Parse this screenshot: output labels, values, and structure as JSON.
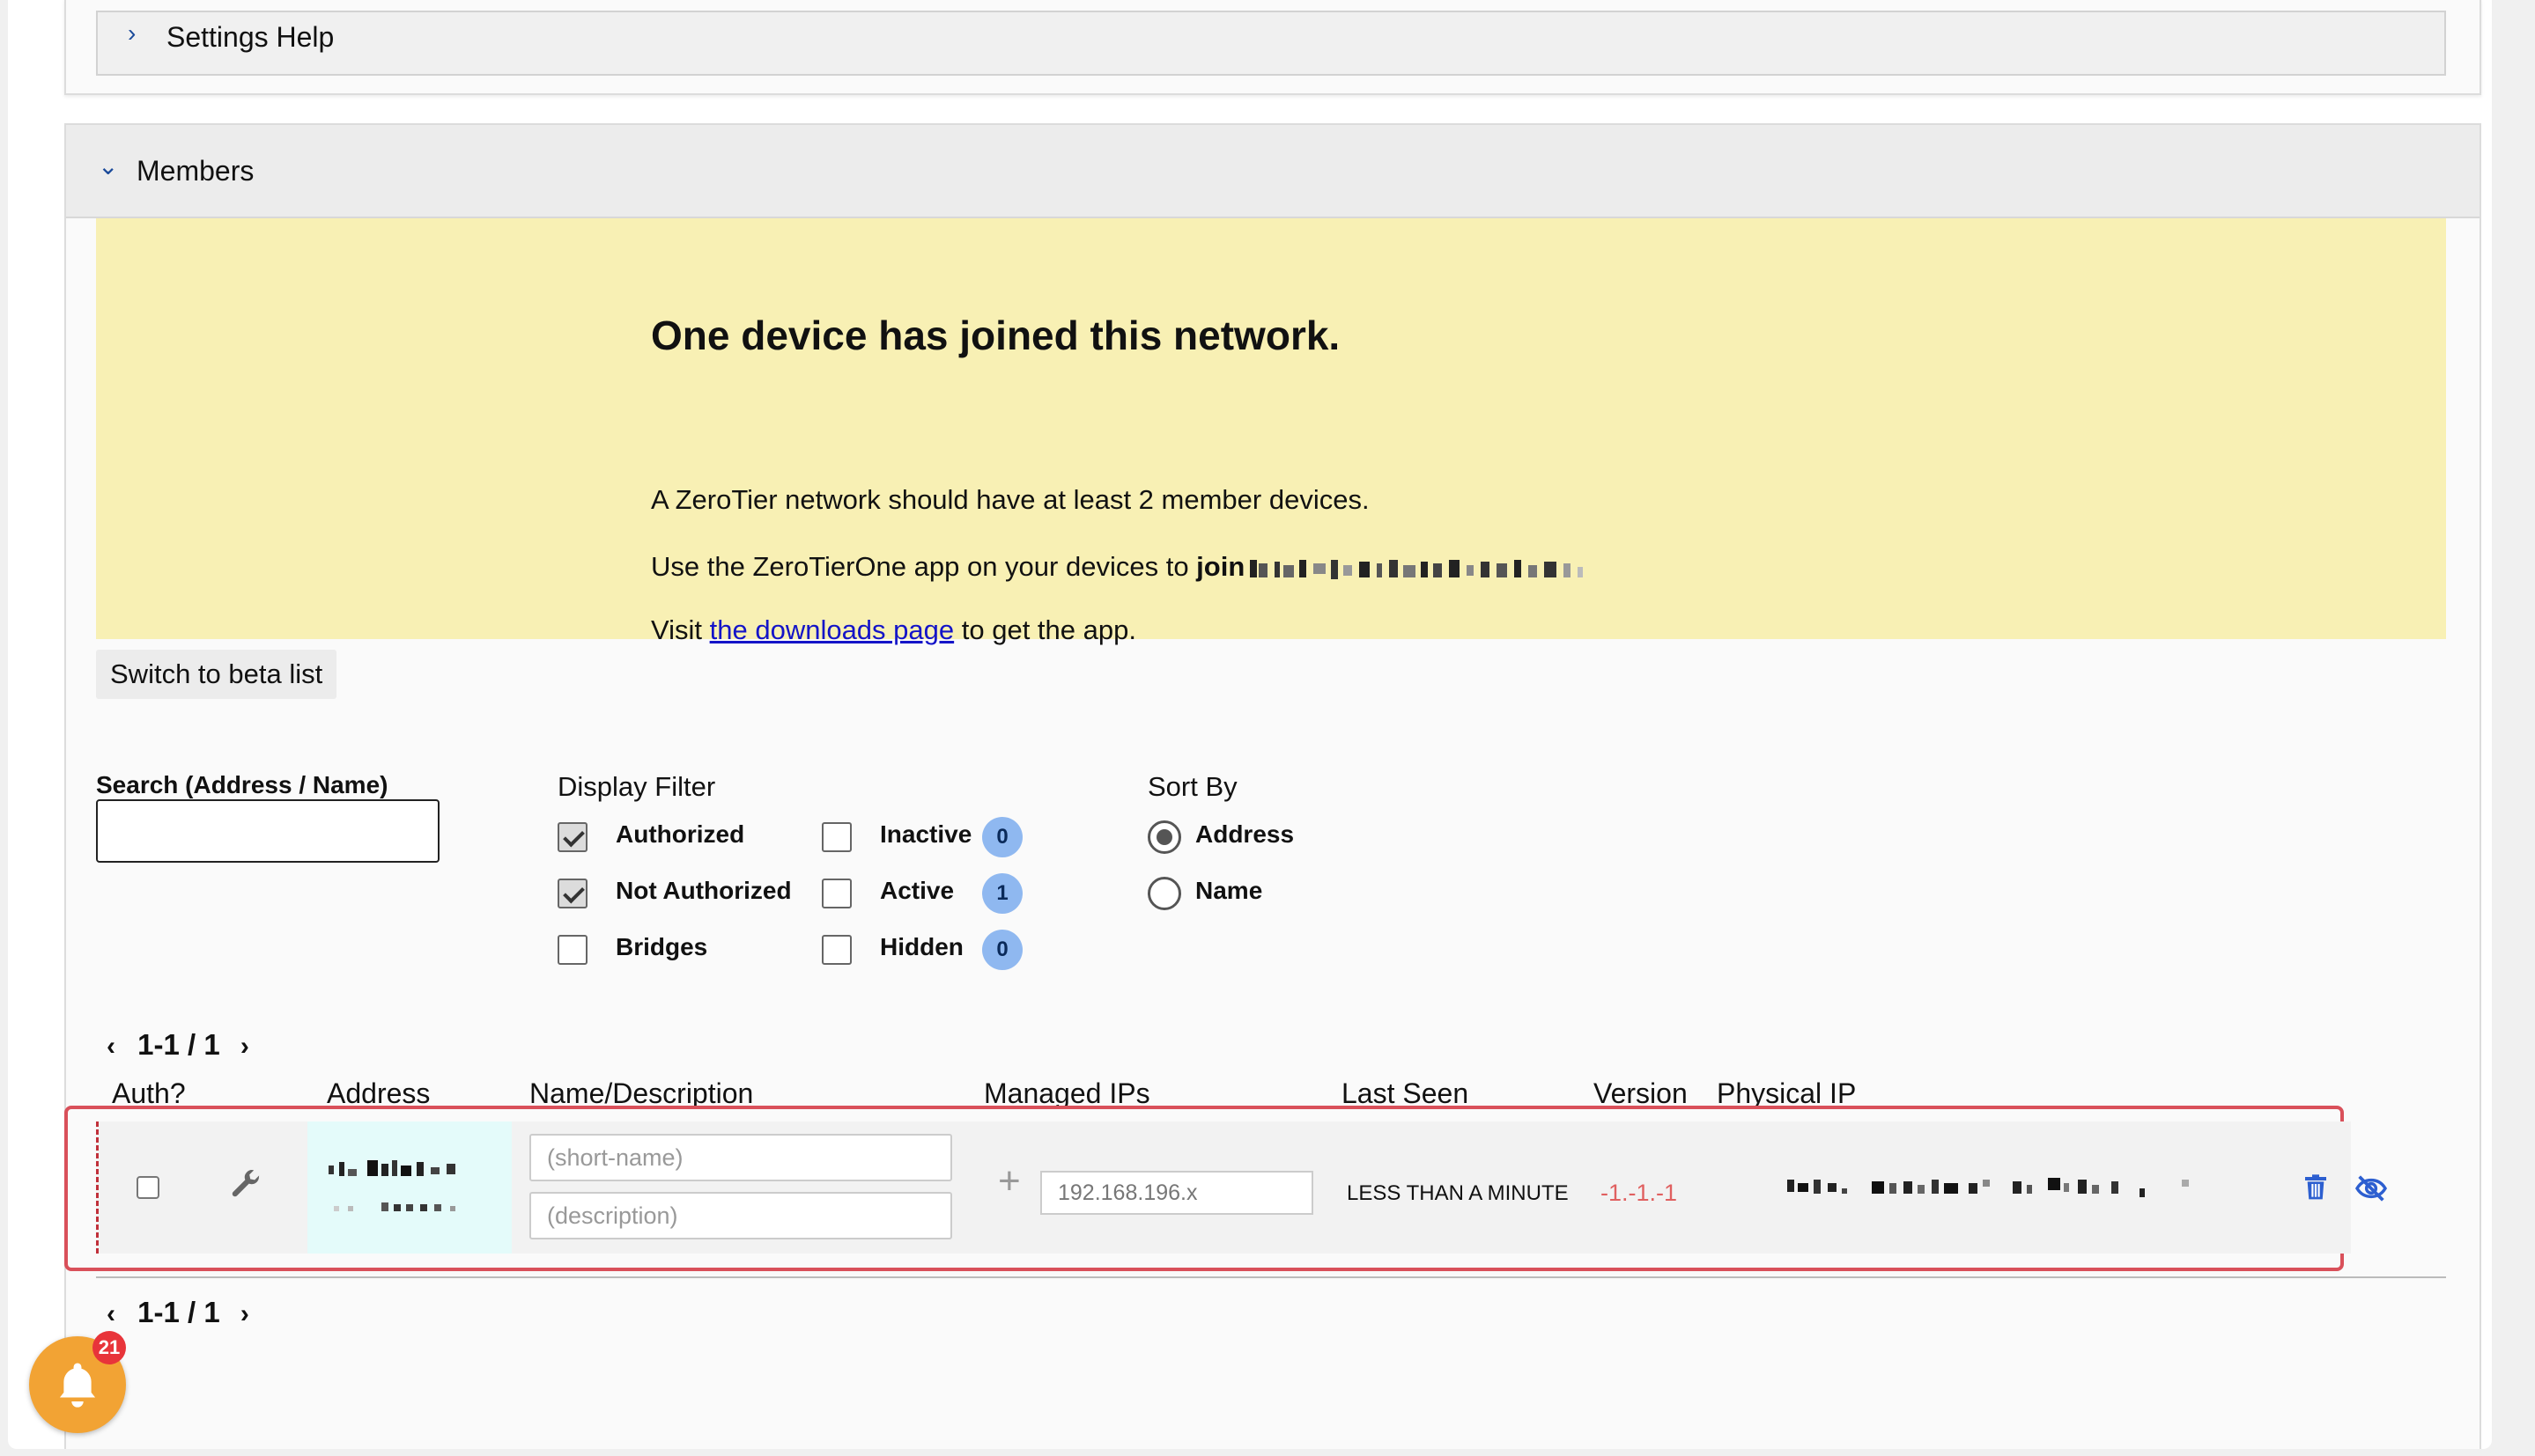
{
  "settings_help": {
    "title": "Settings Help"
  },
  "members": {
    "title": "Members",
    "notice": {
      "heading": "One device has joined this network.",
      "line1": "A ZeroTier network should have at least 2 member devices.",
      "line2_prefix": "Use the ZeroTierOne app on your devices to ",
      "line2_cmd": "join",
      "line3_prefix": "Visit ",
      "line3_link": "the downloads page",
      "line3_suffix": " to get the app."
    },
    "beta_button": "Switch to beta list",
    "search": {
      "label": "Search (Address / Name)",
      "value": ""
    },
    "display_filter": {
      "title": "Display Filter",
      "options": [
        {
          "label": "Authorized",
          "checked": true
        },
        {
          "label": "Not Authorized",
          "checked": true
        },
        {
          "label": "Bridges",
          "checked": false
        },
        {
          "label": "Inactive",
          "checked": false,
          "count": "0"
        },
        {
          "label": "Active",
          "checked": false,
          "count": "1"
        },
        {
          "label": "Hidden",
          "checked": false,
          "count": "0"
        }
      ]
    },
    "sort_by": {
      "title": "Sort By",
      "options": [
        {
          "label": "Address",
          "selected": true
        },
        {
          "label": "Name",
          "selected": false
        }
      ]
    },
    "pager_top": "1-1 / 1",
    "pager_bottom": "1-1 / 1",
    "columns": [
      "Auth?",
      "Address",
      "Name/Description",
      "Managed IPs",
      "Last Seen",
      "Version",
      "Physical IP"
    ],
    "rows": [
      {
        "authorized": false,
        "short_name_placeholder": "(short-name)",
        "description_placeholder": "(description)",
        "managed_ip_placeholder": "192.168.196.x",
        "last_seen": "LESS THAN A MINUTE",
        "version": "-1.-1.-1"
      }
    ]
  },
  "notifications": {
    "count": "21"
  },
  "colors": {
    "accent_link": "#1414c8",
    "notice_bg": "#f8f0b4",
    "highlight": "#d9505a",
    "badge": "#8fb8f0",
    "bell": "#f2a334"
  },
  "icons": [
    "chevron-right-icon",
    "chevron-down-icon",
    "wrench-icon",
    "plus-icon",
    "trash-icon",
    "eye-off-icon",
    "bell-icon"
  ]
}
